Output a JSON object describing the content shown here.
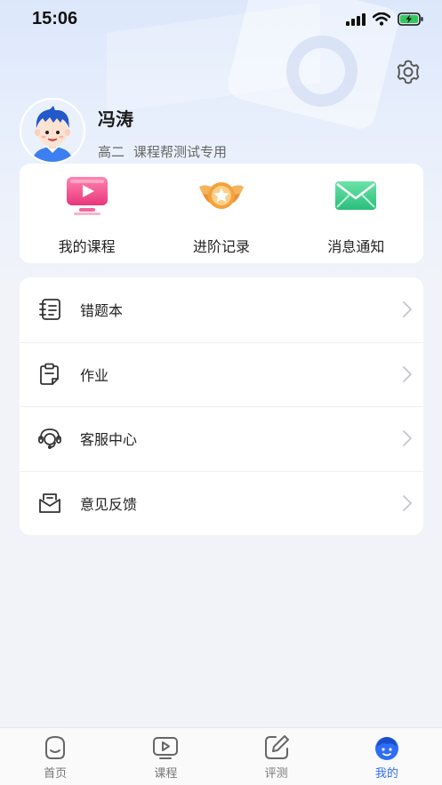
{
  "status_bar": {
    "time": "15:06"
  },
  "profile": {
    "name": "冯涛",
    "grade": "高二",
    "description": "课程帮测试专用"
  },
  "quick_actions": [
    {
      "label": "我的课程",
      "icon": "play-screen-icon"
    },
    {
      "label": "进阶记录",
      "icon": "winged-star-badge-icon"
    },
    {
      "label": "消息通知",
      "icon": "envelope-icon"
    }
  ],
  "menu": [
    {
      "label": "错题本",
      "icon": "notebook-icon"
    },
    {
      "label": "作业",
      "icon": "clipboard-icon"
    },
    {
      "label": "客服中心",
      "icon": "headset-icon"
    },
    {
      "label": "意见反馈",
      "icon": "feedback-mail-icon"
    }
  ],
  "tabs": [
    {
      "label": "首页",
      "icon": "home-face-icon",
      "active": false
    },
    {
      "label": "课程",
      "icon": "course-play-icon",
      "active": false
    },
    {
      "label": "评测",
      "icon": "pen-edit-icon",
      "active": false
    },
    {
      "label": "我的",
      "icon": "profile-face-icon",
      "active": true
    }
  ],
  "colors": {
    "accent": "#2f6df6",
    "background": "#f1f3f9",
    "course_icon": "#f0558e",
    "record_icon": "#f2a546",
    "message_icon": "#3ccf8e"
  }
}
